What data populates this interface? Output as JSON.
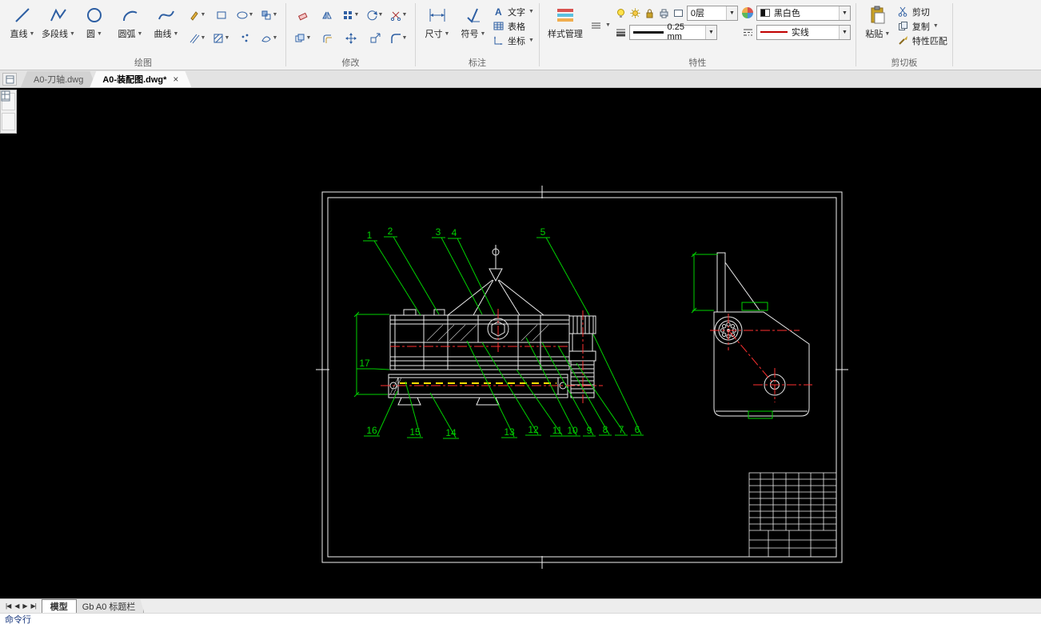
{
  "ribbon": {
    "groups": [
      "绘图",
      "修改",
      "标注",
      "特性",
      "剪切板"
    ],
    "draw": {
      "buttons": [
        "直线",
        "多段线",
        "圆",
        "圆弧",
        "曲线"
      ]
    },
    "annotate": {
      "dimension": "尺寸",
      "symbol": "符号",
      "text": "文字",
      "table": "表格",
      "coordinate": "坐标"
    },
    "properties": {
      "style_manager": "样式管理",
      "layer": "0层",
      "color": "黑白色",
      "lineweight": "0.25 mm",
      "linetype": "实线"
    },
    "clipboard": {
      "paste": "粘贴",
      "cut": "剪切",
      "copy": "复制",
      "match": "特性匹配"
    }
  },
  "file_tabs": [
    {
      "label": "A0-刀轴.dwg",
      "active": false
    },
    {
      "label": "A0-装配图.dwg*",
      "active": true,
      "close": "×"
    }
  ],
  "canvas": {
    "balloons_top": [
      "1",
      "2",
      "3",
      "4",
      "5"
    ],
    "balloons_bottom": [
      "16",
      "15",
      "14",
      "13",
      "12",
      "11",
      "10",
      "9",
      "8",
      "7",
      "6"
    ],
    "balloon_left": "17",
    "colors": {
      "background": "#000000",
      "lines": "#f0f0f0",
      "annotation": "#00d200",
      "centerline": "#ff3030",
      "highlight": "#ffe000"
    }
  },
  "layout_tabs": {
    "model": "模型",
    "titleblock": "Gb A0 标题栏"
  },
  "status": {
    "command": "命令行"
  }
}
